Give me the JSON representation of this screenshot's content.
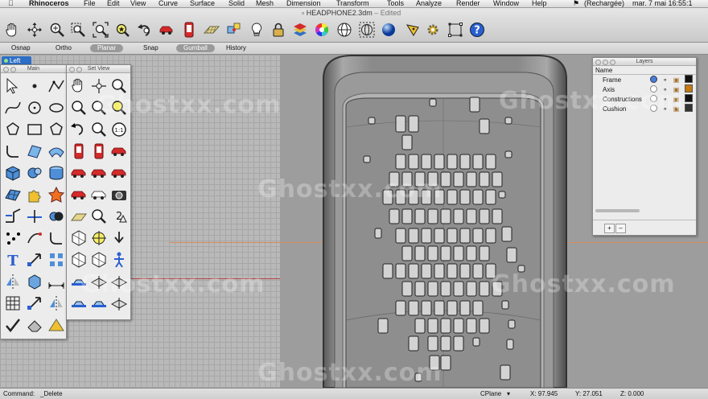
{
  "menubar": {
    "app_name": "Rhinoceros",
    "items": [
      "File",
      "Edit",
      "View",
      "Curve",
      "Surface",
      "Solid",
      "Mesh",
      "Dimension",
      "Transform",
      "Tools",
      "Analyze",
      "Render",
      "Window",
      "Help"
    ],
    "battery": "(Rechargée)",
    "clock": "mar. 7 mai 16:55:1"
  },
  "window": {
    "title": "HEADPHONE2.3dm",
    "status": "– Edited"
  },
  "toolbar": {
    "icons": [
      "pan-hand",
      "rotate-view",
      "zoom-dynamic",
      "zoom-window",
      "zoom-extents",
      "zoom-selected",
      "undo-view",
      "car-red",
      "select-phone",
      "grid-plane",
      "snap-grid",
      "light-bulb",
      "lock",
      "layer-stack",
      "color-wheel",
      "sphere-wire",
      "sphere-grid",
      "sphere-blue",
      "pencil-tip",
      "gear",
      "rectangle-dots",
      "help"
    ]
  },
  "statebar": {
    "items": [
      {
        "label": "Osnap",
        "on": false
      },
      {
        "label": "Ortho",
        "on": false
      },
      {
        "label": "Planar",
        "on": true
      },
      {
        "label": "Snap",
        "on": false
      },
      {
        "label": "Gumball",
        "on": true
      },
      {
        "label": "History",
        "on": false
      }
    ]
  },
  "viewport": {
    "name": "Left"
  },
  "panels": {
    "main": {
      "title": "Main"
    },
    "set_view": {
      "title": "Set View"
    }
  },
  "layers": {
    "title": "Layers",
    "header": "Name",
    "rows": [
      {
        "name": "Frame",
        "current": true,
        "color": "#111111"
      },
      {
        "name": "Axis",
        "current": false,
        "color": "#c47a10"
      },
      {
        "name": "Constructions",
        "current": false,
        "color": "#111111"
      },
      {
        "name": "Cushion",
        "current": false,
        "color": "#333333"
      }
    ],
    "add_label": "+",
    "remove_label": "–"
  },
  "statusbar": {
    "command_label": "Command:",
    "command_value": "_Delete",
    "cplane": "CPlane",
    "x": "X: 97.945",
    "y": "Y: 27.051",
    "z": "Z: 0.000"
  },
  "watermark": "Ghostxx.com",
  "colors": {
    "accent": "#2d6fc4",
    "model_gray": "#8c8c8c",
    "cushion_fill": "#d3d3d3"
  }
}
